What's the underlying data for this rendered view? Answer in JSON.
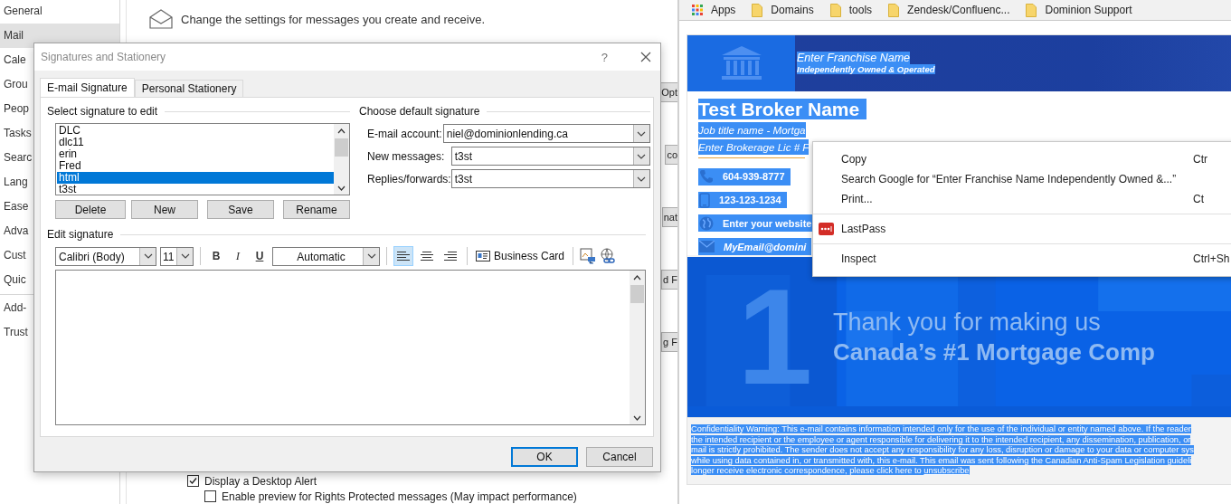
{
  "options_window": {
    "sidebar": [
      {
        "items": [
          {
            "label": "General",
            "selected": false
          },
          {
            "label": "Mail",
            "selected": true
          },
          {
            "label": "Cale",
            "selected": false
          },
          {
            "label": "Grou",
            "selected": false
          },
          {
            "label": "Peop",
            "selected": false
          },
          {
            "label": "Tasks",
            "selected": false
          },
          {
            "label": "Searc",
            "selected": false
          },
          {
            "label": "Lang",
            "selected": false
          },
          {
            "label": "Ease",
            "selected": false
          },
          {
            "label": "Adva",
            "selected": false
          },
          {
            "label": "Cust",
            "selected": false
          },
          {
            "label": "Quic",
            "selected": false
          }
        ]
      },
      {
        "items": [
          {
            "label": "Add-",
            "selected": false
          },
          {
            "label": "Trust",
            "selected": false
          }
        ]
      }
    ],
    "header": "Change the settings for messages you create and receive.",
    "edge_buttons": [
      "Opt",
      "co",
      "nat",
      "d F",
      "g F"
    ],
    "options": [
      {
        "label": "Display a Desktop Alert",
        "checked": true
      },
      {
        "label": "Enable preview for Rights Protected messages (May impact performance)",
        "checked": false
      }
    ]
  },
  "dialog": {
    "title": "Signatures and Stationery",
    "help": "?",
    "tabs": [
      {
        "label": "E-mail Signature",
        "selected": true
      },
      {
        "label": "Personal Stationery",
        "selected": false
      }
    ],
    "select_heading": "Select signature to edit",
    "signatures": [
      {
        "name": "DLC",
        "selected": false
      },
      {
        "name": "dlc11",
        "selected": false
      },
      {
        "name": "erin",
        "selected": false
      },
      {
        "name": "Fred",
        "selected": false
      },
      {
        "name": "html",
        "selected": true
      },
      {
        "name": "t3st",
        "selected": false
      }
    ],
    "buttons": [
      "Delete",
      "New",
      "Save",
      "Rename"
    ],
    "default_heading": "Choose default signature",
    "defaults": [
      {
        "label": "E-mail account:",
        "value": "niel@dominionlending.ca"
      },
      {
        "label": "New messages:",
        "value": "t3st"
      },
      {
        "label": "Replies/forwards:",
        "value": "t3st"
      }
    ],
    "edit_heading": "Edit signature",
    "toolbar": {
      "font": "Calibri (Body)",
      "size": "11",
      "bold": "B",
      "italic": "I",
      "underline": "U",
      "color_menu": "Automatic",
      "alignment": [
        {
          "kind": "left",
          "selected": true
        },
        {
          "kind": "center",
          "selected": false
        },
        {
          "kind": "right",
          "selected": false
        }
      ],
      "business_card": "Business Card"
    },
    "footer_buttons": [
      "OK",
      "Cancel"
    ]
  },
  "browser": {
    "bookmarks": [
      {
        "kind": "apps",
        "label": "Apps"
      },
      {
        "kind": "folder",
        "label": "Domains"
      },
      {
        "kind": "folder",
        "label": "tools"
      },
      {
        "kind": "folder",
        "label": "Zendesk/Confluenc..."
      },
      {
        "kind": "folder",
        "label": "Dominion Support"
      }
    ],
    "signature": {
      "text_selected": true,
      "franchise": "Enter Franchise Name",
      "tagline": "Independently Owned & Operated",
      "broker": "Test Broker Name",
      "job_title": "Job title name - Mortga",
      "license": "Enter Brokerage Lic # F",
      "contacts": [
        {
          "kind": "phone",
          "text": "604-939-8777"
        },
        {
          "kind": "mobile",
          "text": "123-123-1234"
        },
        {
          "kind": "web",
          "text": "Enter your website"
        },
        {
          "kind": "email",
          "text": "MyEmail@domini"
        }
      ],
      "banner": {
        "numeral": "1",
        "lines": [
          "Thank you for making us",
          "Canada’s #1 Mortgage Comp"
        ]
      },
      "disclaimer": {
        "lines": [
          "Confidentiality Warning: This e-mail contains information intended only for the use of the individual or entity named above. If the reader",
          "the intended recipient or the employee or agent responsible for delivering it to the intended recipient, any dissemination, publication, or",
          "mail is strictly prohibited. The sender does not accept any responsibility for any loss, disruption or damage to your data or computer sys",
          "while using data contained in, or transmitted with, this e-mail. This email was sent following the Canadian Anti-Spam Legislation guideli",
          "longer receive electronic correspondence, please click here to "
        ],
        "link": "unsubscribe"
      }
    },
    "context_menu": [
      {
        "kind": "item",
        "label": "Copy",
        "shortcut": "Ctr"
      },
      {
        "kind": "item",
        "label": "Search Google for “Enter Franchise Name Independently Owned &...”"
      },
      {
        "kind": "item",
        "label": "Print...",
        "shortcut": "Ct"
      },
      {
        "kind": "separator"
      },
      {
        "kind": "extension",
        "label": "LastPass"
      },
      {
        "kind": "separator"
      },
      {
        "kind": "item",
        "label": "Inspect",
        "shortcut": "Ctrl+Sh"
      }
    ]
  }
}
